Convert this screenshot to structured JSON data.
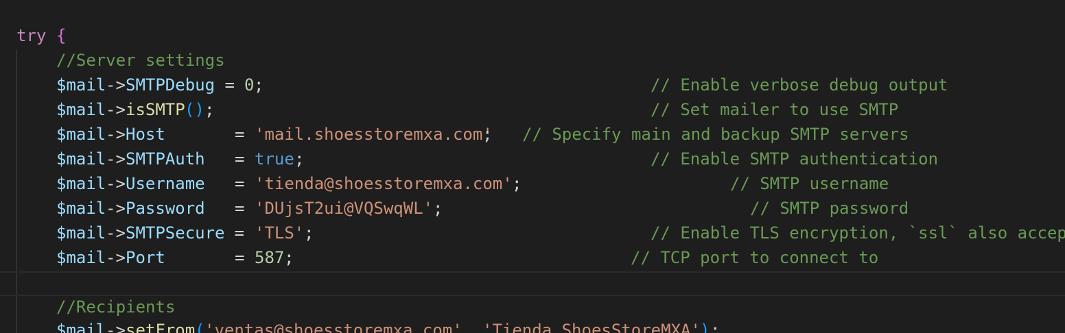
{
  "code": {
    "try_kw": "try",
    "try_brace": "{",
    "comment_server": "//Server settings",
    "var": "$mail",
    "arrow": "->",
    "lines": [
      {
        "prop": "SMTPDebug",
        "assign": " = ",
        "value": "0",
        "end": ";",
        "comment": "// Enable verbose debug output"
      },
      {
        "prop": "isSMTP",
        "call": "()",
        "end": ";",
        "comment": "// Set mailer to use SMTP"
      },
      {
        "prop": "Host",
        "assign": "= ",
        "value": "'mail.shoesstoremxa.com'",
        "end": ";",
        "comment": "// Specify main and backup SMTP servers"
      },
      {
        "prop": "SMTPAuth",
        "assign": "= ",
        "value": "true",
        "end": ";",
        "comment": "// Enable SMTP authentication"
      },
      {
        "prop": "Username",
        "assign": "= ",
        "value": "'tienda@shoesstoremxa.com'",
        "end": ";",
        "comment": "// SMTP username"
      },
      {
        "prop": "Password",
        "assign": "= ",
        "value": "'DUjsT2ui@VQSwqWL'",
        "end": ";",
        "comment": "// SMTP password"
      },
      {
        "prop": "SMTPSecure",
        "assign": " = ",
        "value": "'TLS'",
        "end": ";",
        "comment": "// Enable TLS encryption, `ssl` also accep"
      },
      {
        "prop": "Port",
        "assign": "= ",
        "value": "587",
        "end": ";",
        "comment": "// TCP port to connect to"
      }
    ],
    "comment_recipients": "//Recipients",
    "setfrom_fn": "setFrom",
    "setfrom_open": "(",
    "setfrom_arg1": "'ventas@shoesstoremxa.com'",
    "setfrom_sep": ", ",
    "setfrom_arg2": "'Tienda ShoesStoreMXA'",
    "setfrom_close": ")",
    "setfrom_end": ";"
  }
}
